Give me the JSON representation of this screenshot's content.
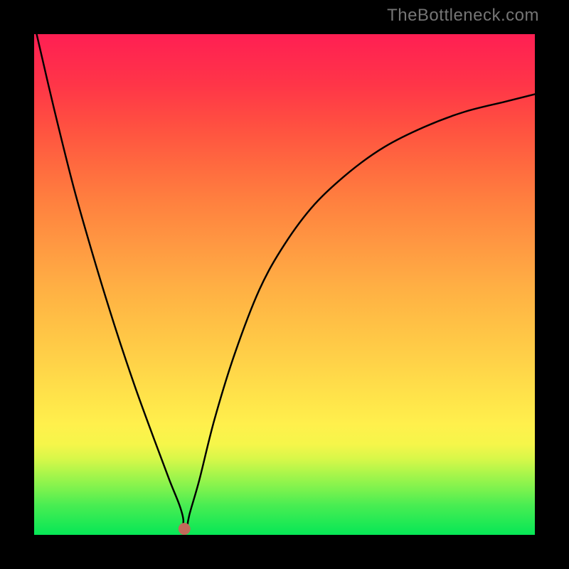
{
  "watermark": "TheBottleneck.com",
  "chart_data": {
    "type": "line",
    "title": "",
    "xlabel": "",
    "ylabel": "",
    "xlim": [
      0,
      100
    ],
    "ylim": [
      0,
      100
    ],
    "background_bands": [
      {
        "y": 0,
        "color": "#06e756"
      },
      {
        "y": 6,
        "color": "#4aed52"
      },
      {
        "y": 9,
        "color": "#7af24e"
      },
      {
        "y": 12,
        "color": "#a6f54b"
      },
      {
        "y": 15,
        "color": "#d5f749"
      },
      {
        "y": 18,
        "color": "#f5f64a"
      },
      {
        "y": 22,
        "color": "#fff04c"
      },
      {
        "y": 28,
        "color": "#ffe24a"
      },
      {
        "y": 35,
        "color": "#ffd148"
      },
      {
        "y": 42,
        "color": "#ffc145"
      },
      {
        "y": 50,
        "color": "#ffae44"
      },
      {
        "y": 58,
        "color": "#ff9842"
      },
      {
        "y": 66,
        "color": "#ff823f"
      },
      {
        "y": 74,
        "color": "#ff693f"
      },
      {
        "y": 82,
        "color": "#ff4f41"
      },
      {
        "y": 90,
        "color": "#ff3548"
      },
      {
        "y": 100,
        "color": "#ff1f53"
      }
    ],
    "curve_left": [
      {
        "x": 0.5,
        "y": 100
      },
      {
        "x": 4,
        "y": 85
      },
      {
        "x": 8,
        "y": 69
      },
      {
        "x": 12,
        "y": 55
      },
      {
        "x": 16,
        "y": 42
      },
      {
        "x": 20,
        "y": 30
      },
      {
        "x": 24,
        "y": 19
      },
      {
        "x": 27,
        "y": 11
      },
      {
        "x": 29,
        "y": 6
      },
      {
        "x": 29.8,
        "y": 3
      },
      {
        "x": 29.5,
        "y": 1
      }
    ],
    "curve_right": [
      {
        "x": 30.5,
        "y": 1
      },
      {
        "x": 31,
        "y": 4
      },
      {
        "x": 33,
        "y": 11
      },
      {
        "x": 36,
        "y": 23
      },
      {
        "x": 40,
        "y": 36
      },
      {
        "x": 45,
        "y": 49
      },
      {
        "x": 50,
        "y": 58
      },
      {
        "x": 56,
        "y": 66
      },
      {
        "x": 63,
        "y": 72.5
      },
      {
        "x": 70,
        "y": 77.5
      },
      {
        "x": 78,
        "y": 81.5
      },
      {
        "x": 86,
        "y": 84.5
      },
      {
        "x": 94,
        "y": 86.5
      },
      {
        "x": 100,
        "y": 88
      }
    ],
    "marker": {
      "x": 30,
      "y": 1.2,
      "color": "#c26a5a",
      "radius": 1.2
    }
  }
}
